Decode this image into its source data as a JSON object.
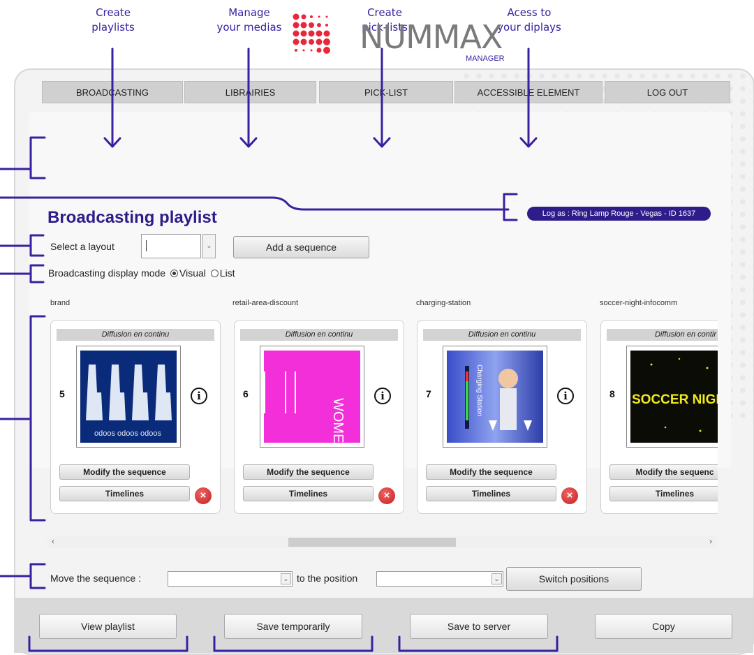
{
  "annotations": [
    {
      "line1": "Create",
      "line2": "playlists"
    },
    {
      "line1": "Manage",
      "line2": "your medias"
    },
    {
      "line1": "Create",
      "line2": "pick-lists"
    },
    {
      "line1": "Acess to",
      "line2": "your diplays"
    }
  ],
  "logo": {
    "brand": "NUMMAX",
    "sub": "MANAGER"
  },
  "nav": [
    "BROADCASTING",
    "LIBRAIRIES",
    "PICK-LIST",
    "ACCESSIBLE ELEMENT",
    "LOG OUT"
  ],
  "page_title": "Broadcasting playlist",
  "logged_as": "Log as : Ring Lamp Rouge - Vegas - ID 1637",
  "layout": {
    "label": "Select a layout",
    "value": "",
    "add_label": "Add a sequence"
  },
  "display_mode": {
    "label": "Broadcasting display mode",
    "visual": "Visual",
    "list": "List",
    "selected": "Visual"
  },
  "sequences": [
    {
      "name": "brand",
      "banner": "Diffusion en continu",
      "number": "5",
      "modify": "Modify the sequence",
      "timelines": "Timelines",
      "image_text": "odoos"
    },
    {
      "name": "retail-area-discount",
      "banner": "Diffusion en continu",
      "number": "6",
      "modify": "Modify the sequence",
      "timelines": "Timelines",
      "image_text": "WOMEN"
    },
    {
      "name": "charging-station",
      "banner": "Diffusion en continu",
      "number": "7",
      "modify": "Modify the sequence",
      "timelines": "Timelines",
      "image_text": "Charging Station"
    },
    {
      "name": "soccer-night-infocomm",
      "banner": "Diffusion en contir",
      "number": "8",
      "modify": "Modify the sequenc",
      "timelines": "Timelines",
      "image_text": "SOCCER NIGHT"
    }
  ],
  "move": {
    "label": "Move the sequence :",
    "to_label": "to the position",
    "switch_label": "Switch positions"
  },
  "actions": {
    "view": "View playlist",
    "save_temp": "Save temporarily",
    "save_server": "Save to server",
    "copy": "Copy"
  },
  "colors": {
    "accent": "#3a1fa0",
    "brand_red": "#e8273a",
    "title": "#2e1c8a"
  }
}
